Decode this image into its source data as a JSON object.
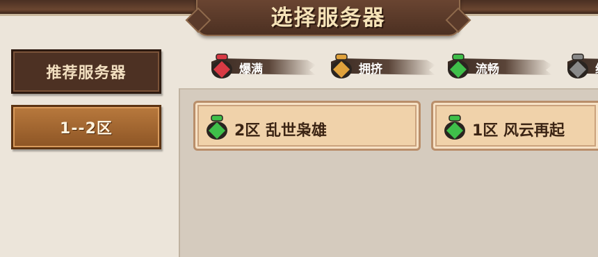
{
  "header": {
    "title": "选择服务器"
  },
  "sidebar": {
    "recommended_label": "推荐服务器",
    "zone_range_label": "1--2区"
  },
  "legend": [
    {
      "label": "爆满",
      "color": "#d83a44"
    },
    {
      "label": "拥挤",
      "color": "#e0a23c"
    },
    {
      "label": "流畅",
      "color": "#3fbf4a"
    },
    {
      "label": "维",
      "color": "#8a8a8a"
    }
  ],
  "servers": [
    {
      "name": "2区 乱世枭雄",
      "status_color": "#3fbf4a"
    },
    {
      "name": "1区 风云再起",
      "status_color": "#3fbf4a"
    }
  ]
}
